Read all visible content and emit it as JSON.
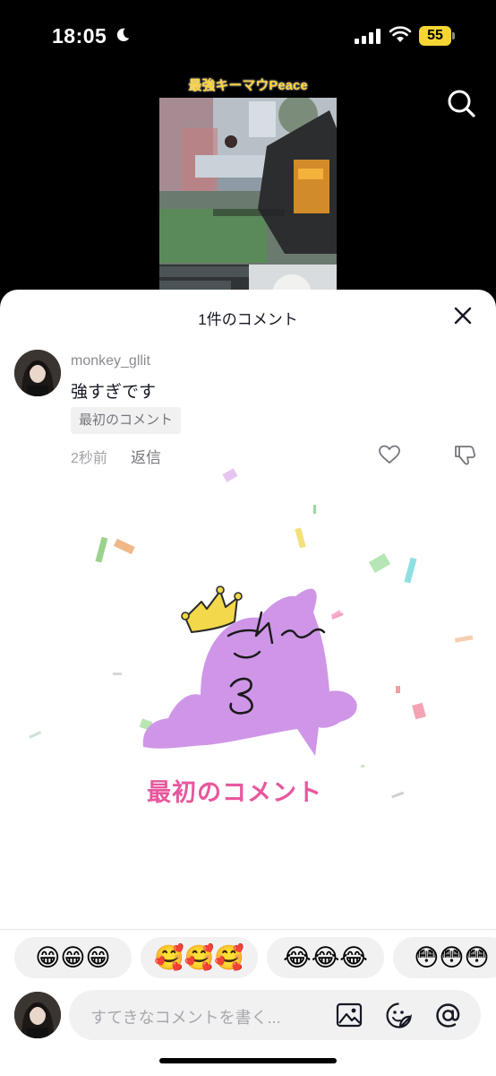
{
  "status_bar": {
    "time": "18:05",
    "battery": "55"
  },
  "video": {
    "overlay_title": "最強キーマウPeace"
  },
  "sheet": {
    "title": "1件のコメント"
  },
  "comment": {
    "username": "monkey_gllit",
    "text": "強すぎです",
    "badge": "最初のコメント",
    "time_ago": "2秒前",
    "reply_label": "返信"
  },
  "celebration": {
    "text": "最初のコメント"
  },
  "emoji_bar": [
    {
      "emoji": "😁😁😁"
    },
    {
      "emoji": "🥰🥰🥰"
    },
    {
      "emoji": "😂😂😂"
    },
    {
      "emoji": "😳😳😳"
    }
  ],
  "input": {
    "placeholder": "すてきなコメントを書く..."
  },
  "colors": {
    "accent_pink": "#e8579d",
    "character_purple": "#cf96e8",
    "crown_yellow": "#f2d84a"
  }
}
